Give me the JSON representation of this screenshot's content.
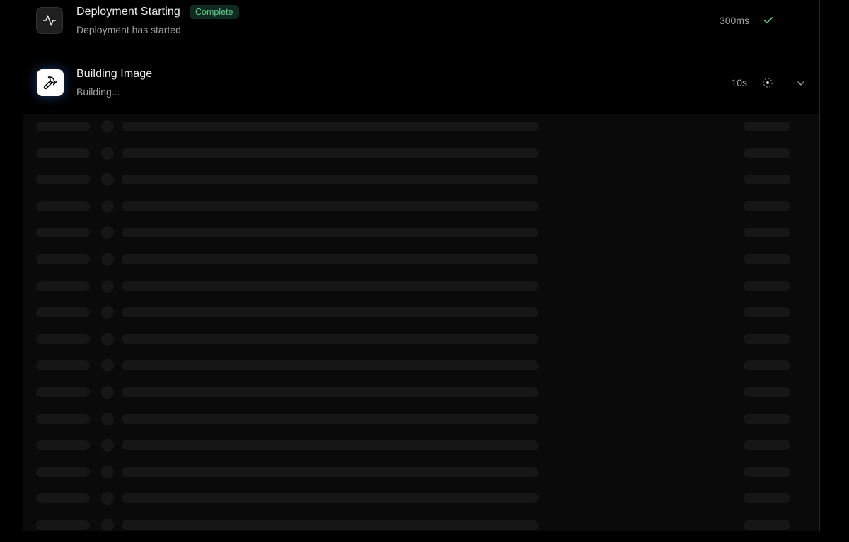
{
  "steps": [
    {
      "title": "Deployment Starting",
      "badge": "Complete",
      "subtitle": "Deployment has started",
      "duration": "300ms",
      "status": "complete",
      "icon": "activity-icon",
      "status_icon": "check-icon"
    },
    {
      "title": "Building Image",
      "subtitle": "Building...",
      "duration": "10s",
      "status": "in-progress",
      "icon": "hammer-icon",
      "status_icon": "spinner-icon",
      "expand_icon": "chevron-down-icon"
    }
  ],
  "logs": {
    "state": "loading",
    "skeleton_row_count": 16
  },
  "colors": {
    "background": "#000000",
    "border": "#262626",
    "badge_bg": "#0f2a1e",
    "badge_text": "#62c98f",
    "check": "#62c98f",
    "glow": "#3b82f6",
    "skeleton": "#161616"
  }
}
